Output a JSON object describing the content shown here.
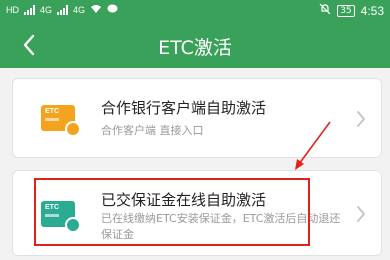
{
  "status_bar": {
    "network_left": "HD",
    "network_4g_1": "4G",
    "network_4g_2": "4G",
    "battery": "35",
    "time": "4:53"
  },
  "nav": {
    "title": "ETC激活",
    "back_icon": "chevron-left-icon"
  },
  "cards": [
    {
      "title": "合作银行客户端自助激活",
      "subtitle": "合作客户端 直接入口",
      "icon_label": "ETC",
      "icon_color": "#f4a31f"
    },
    {
      "title": "已交保证金在线自助激活",
      "subtitle": "已在线缴纳ETC安装保证金，ETC激活后自动退还保证金",
      "icon_label": "ETC",
      "icon_color": "#2bab93"
    }
  ],
  "colors": {
    "header": "#3aa15a",
    "annotation": "#e0231d"
  }
}
